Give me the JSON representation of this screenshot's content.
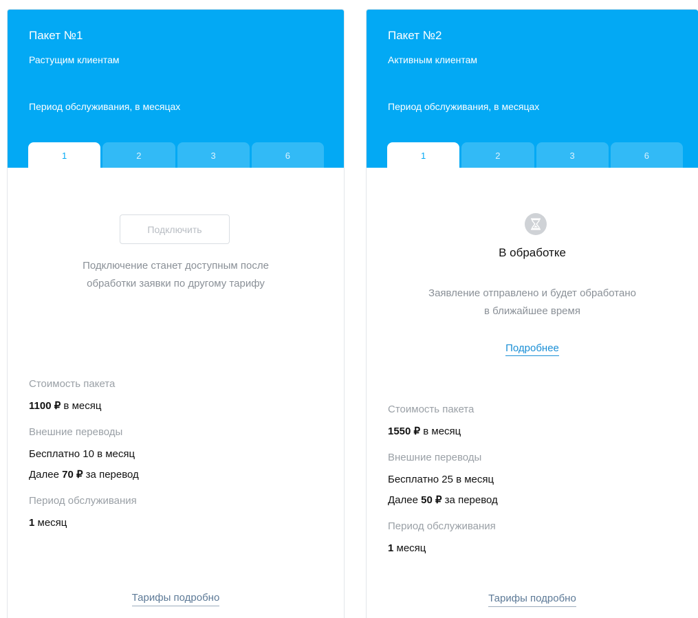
{
  "packages": [
    {
      "title": "Пакет №1",
      "subtitle": "Растущим клиентам",
      "period_label": "Период обслуживания, в месяцах",
      "tabs": [
        "1",
        "2",
        "3",
        "6"
      ],
      "active_tab": "1",
      "connect_label": "Подключить",
      "note_line1": "Подключение станет доступным после",
      "note_line2": "обработки заявки по другому тарифу",
      "cost_label": "Стоимость пакета",
      "cost_amount": "1100 ₽",
      "cost_unit": " в месяц",
      "transfers_label": "Внешние переводы",
      "transfers_free": "Бесплатно 10 в месяц",
      "transfers_extra_prefix": "Далее ",
      "transfers_extra_amount": "70 ₽",
      "transfers_extra_suffix": " за перевод",
      "period_info_label": "Период обслуживания",
      "period_value": "1",
      "period_unit": " месяц",
      "tariffs_link": "Тарифы подробно"
    },
    {
      "title": "Пакет №2",
      "subtitle": "Активным клиентам",
      "period_label": "Период обслуживания, в месяцах",
      "tabs": [
        "1",
        "2",
        "3",
        "6"
      ],
      "active_tab": "1",
      "status_icon": "hourglass-icon",
      "status_title": "В обработке",
      "note_line1": "Заявление отправлено и будет обработано",
      "note_line2": "в ближайшее время",
      "more_link": "Подробнее",
      "cost_label": "Стоимость пакета",
      "cost_amount": "1550 ₽",
      "cost_unit": " в месяц",
      "transfers_label": "Внешние переводы",
      "transfers_free": "Бесплатно 25 в месяц",
      "transfers_extra_prefix": "Далее ",
      "transfers_extra_amount": "50 ₽",
      "transfers_extra_suffix": " за перевод",
      "period_info_label": "Период обслуживания",
      "period_value": "1",
      "period_unit": " месяц",
      "tariffs_link": "Тарифы подробно"
    }
  ],
  "colors": {
    "header_blue": "#03a9f4",
    "tab_inactive": "#32baf6",
    "link_blue": "#1a8fd6"
  }
}
